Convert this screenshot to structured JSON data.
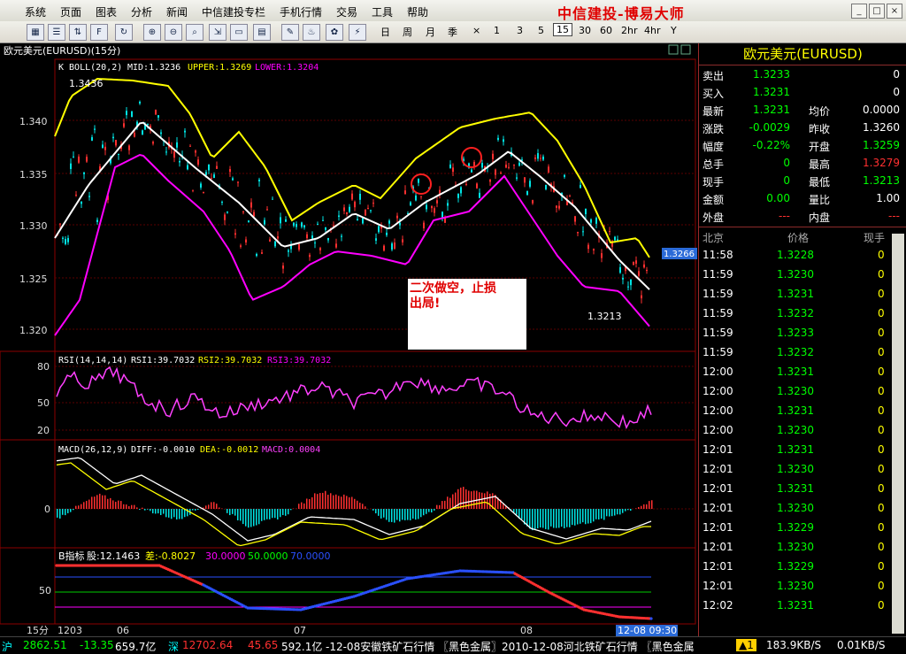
{
  "menu": [
    "系统",
    "页面",
    "图表",
    "分析",
    "新闻",
    "中信建投专栏",
    "手机行情",
    "交易",
    "工具",
    "帮助"
  ],
  "brand": "中信建投-博易大师",
  "window_buttons": [
    "_",
    "□",
    "×"
  ],
  "toolbar_icons": [
    "grid-icon",
    "list-icon",
    "sort-icon",
    "f10-icon",
    "refresh-icon",
    "zoom-in-icon",
    "zoom-out-icon",
    "export-icon",
    "window-icon",
    "edit-icon",
    "alarm-icon",
    "gift-icon",
    "flash-icon"
  ],
  "periods": [
    "日",
    "周",
    "月",
    "季",
    "×",
    "1",
    "3",
    "5",
    "15",
    "30",
    "60",
    "2hr",
    "4hr",
    "Y"
  ],
  "selected_period": "15",
  "chart": {
    "title": "欧元美元(EURUSD)(15分)",
    "boll_header": {
      "prefix": "K  BOLL(20,2)",
      "mid": "MID:1.3236",
      "upper": "UPPER:1.3269",
      "lower": "LOWER:1.3204"
    },
    "price_ticks": [
      "1.340",
      "1.335",
      "1.330",
      "1.325",
      "1.320"
    ],
    "high_label": "1.3436",
    "low_label": "1.3213",
    "current_price": "1.3266",
    "annotation": "二次做空，止损出局!",
    "rsi_header": {
      "prefix": "RSI(14,14,14)",
      "r1": "RSI1:39.7032",
      "r2": "RSI2:39.7032",
      "r3": "RSI3:39.7032"
    },
    "rsi_ticks": [
      "80",
      "50",
      "20"
    ],
    "macd_header": {
      "prefix": "MACD(26,12,9)",
      "diff": "DIFF:-0.0010",
      "dea": "DEA:-0.0012",
      "macd": "MACD:0.0004"
    },
    "macd_tick": "0",
    "b_header": {
      "prefix": "B指标",
      "a": "股:12.1463",
      "b": "差:-0.8027",
      "c": "30.0000",
      "d": "50.0000",
      "e": "70.0000"
    },
    "b_tick": "50",
    "x_labels": [
      "15分",
      "1203",
      "06",
      "07",
      "08"
    ],
    "time_badge": "12-08 09:30"
  },
  "quote": {
    "title": "欧元美元(EURUSD)",
    "rows": [
      {
        "l1": "卖出",
        "v1": "1.3233",
        "l2": "",
        "v2": "0"
      },
      {
        "l1": "买入",
        "v1": "1.3231",
        "l2": "",
        "v2": "0"
      },
      {
        "l1": "最新",
        "v1": "1.3231",
        "l2": "均价",
        "v2": "0.0000"
      },
      {
        "l1": "涨跌",
        "v1": "-0.0029",
        "l2": "昨收",
        "v2": "1.3260"
      },
      {
        "l1": "幅度",
        "v1": "-0.22%",
        "l2": "开盘",
        "v2": "1.3259"
      },
      {
        "l1": "总手",
        "v1": "0",
        "l2": "最高",
        "v2": "1.3279"
      },
      {
        "l1": "现手",
        "v1": "0",
        "l2": "最低",
        "v2": "1.3213"
      },
      {
        "l1": "金额",
        "v1": "0.00",
        "l2": "量比",
        "v2": "1.00"
      },
      {
        "l1": "外盘",
        "v1": "---",
        "l2": "内盘",
        "v2": "---"
      }
    ],
    "tick_header": {
      "time": "北京",
      "price": "价格",
      "vol": "现手"
    },
    "ticks": [
      {
        "t": "11:58",
        "p": "1.3228",
        "v": "0"
      },
      {
        "t": "11:59",
        "p": "1.3230",
        "v": "0"
      },
      {
        "t": "11:59",
        "p": "1.3231",
        "v": "0"
      },
      {
        "t": "11:59",
        "p": "1.3232",
        "v": "0"
      },
      {
        "t": "11:59",
        "p": "1.3233",
        "v": "0"
      },
      {
        "t": "11:59",
        "p": "1.3232",
        "v": "0"
      },
      {
        "t": "12:00",
        "p": "1.3231",
        "v": "0"
      },
      {
        "t": "12:00",
        "p": "1.3230",
        "v": "0"
      },
      {
        "t": "12:00",
        "p": "1.3231",
        "v": "0"
      },
      {
        "t": "12:00",
        "p": "1.3230",
        "v": "0"
      },
      {
        "t": "12:01",
        "p": "1.3231",
        "v": "0"
      },
      {
        "t": "12:01",
        "p": "1.3230",
        "v": "0"
      },
      {
        "t": "12:01",
        "p": "1.3231",
        "v": "0"
      },
      {
        "t": "12:01",
        "p": "1.3230",
        "v": "0"
      },
      {
        "t": "12:01",
        "p": "1.3229",
        "v": "0"
      },
      {
        "t": "12:01",
        "p": "1.3230",
        "v": "0"
      },
      {
        "t": "12:01",
        "p": "1.3229",
        "v": "0"
      },
      {
        "t": "12:01",
        "p": "1.3230",
        "v": "0"
      },
      {
        "t": "12:02",
        "p": "1.3231",
        "v": "0"
      }
    ]
  },
  "status": {
    "sh_label": "沪",
    "sh_index": "2862.51",
    "sh_change": "-13.35",
    "sh_amount": "659.7亿",
    "sz_label": "深",
    "sz_index": "12702.64",
    "sz_change": "45.65",
    "sz_amount": "592.1亿",
    "news": "-12-08安徽铁矿石行情 〖黑色金属〗2010-12-08河北铁矿石行情 〖黑色金属",
    "alert": "1",
    "down_speed": "183.9KB/S",
    "up_speed": "0.01KB/S"
  },
  "colors": {
    "up": "#ff3030",
    "down": "#00e5e5",
    "upper": "#ffff00",
    "mid": "#ffffff",
    "lower": "#ff00ff",
    "grid": "#8b0000",
    "green": "#00ff00"
  }
}
